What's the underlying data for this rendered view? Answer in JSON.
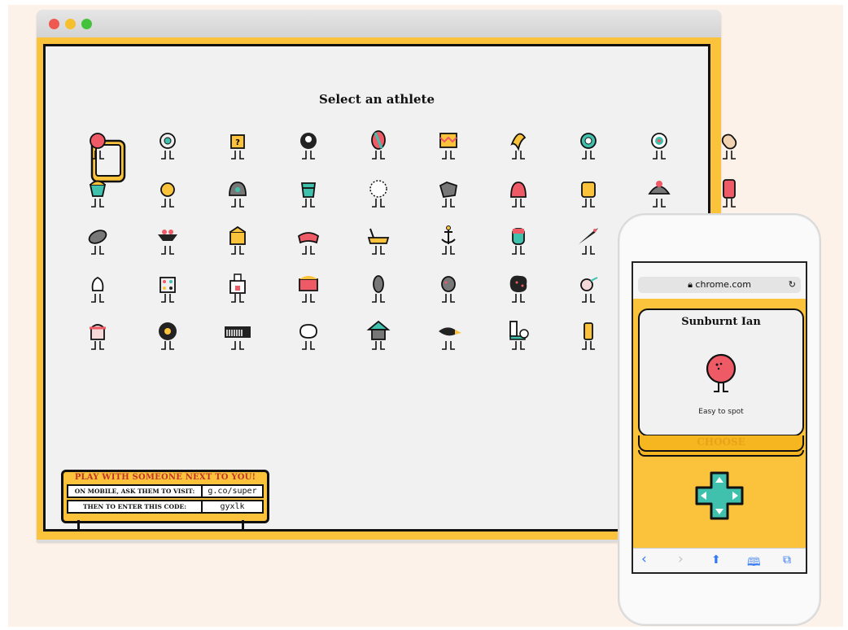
{
  "desktop": {
    "title": "Select an athlete",
    "athlete_count": 50,
    "selected_index": 0
  },
  "sign": {
    "headline": "PLAY WITH SOMEONE NEXT TO YOU!",
    "visit_label": "ON MOBILE, ASK THEM TO VISIT:",
    "visit_url": "g.co/super",
    "code_label": "THEN TO ENTER THIS CODE:",
    "code": "gyxlk"
  },
  "phone": {
    "url": "chrome.com",
    "athlete_name": "Sunburnt Ian",
    "athlete_desc": "Easy to spot",
    "choose_label": "CHOOSE"
  },
  "icons": {
    "lock": "lock-icon",
    "reload": "reload-icon",
    "back": "back-arrow-icon",
    "forward": "forward-arrow-icon",
    "share": "share-icon",
    "bookmarks": "bookmarks-icon",
    "tabs": "tabs-icon",
    "dpad": "dpad-icon"
  },
  "colors": {
    "yellow": "#fbc23b",
    "red": "#ee5a66",
    "teal": "#3fc1ae",
    "dark": "#111111"
  }
}
